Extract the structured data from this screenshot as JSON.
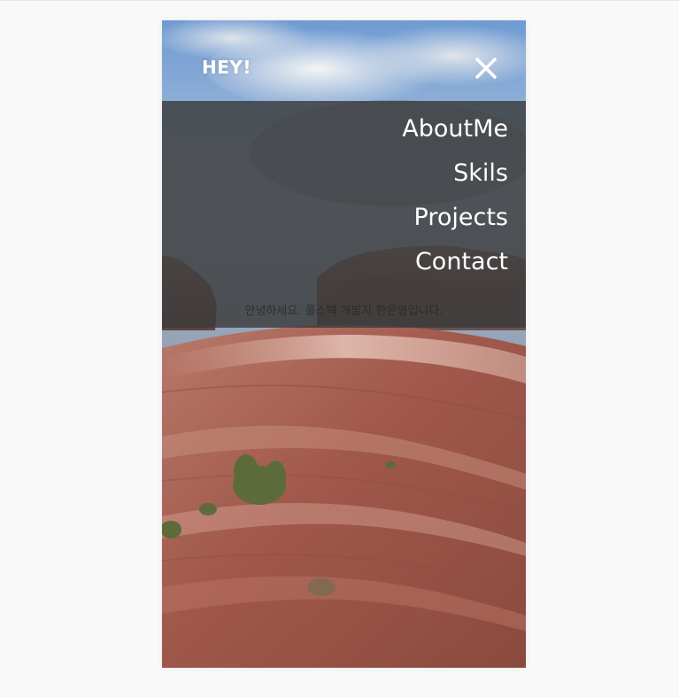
{
  "header": {
    "brand": "HEY!",
    "close_icon": "close-icon"
  },
  "menu": {
    "items": [
      {
        "label": "AboutMe"
      },
      {
        "label": "Skils"
      },
      {
        "label": "Projects"
      },
      {
        "label": "Contact"
      }
    ]
  },
  "hero": {
    "greeting": "안녕하세요. 풀스택 개발자 한은영입니다."
  },
  "colors": {
    "page_background": "#f9f9f9",
    "menu_overlay": "#3a3a3a",
    "text": "#ffffff"
  }
}
